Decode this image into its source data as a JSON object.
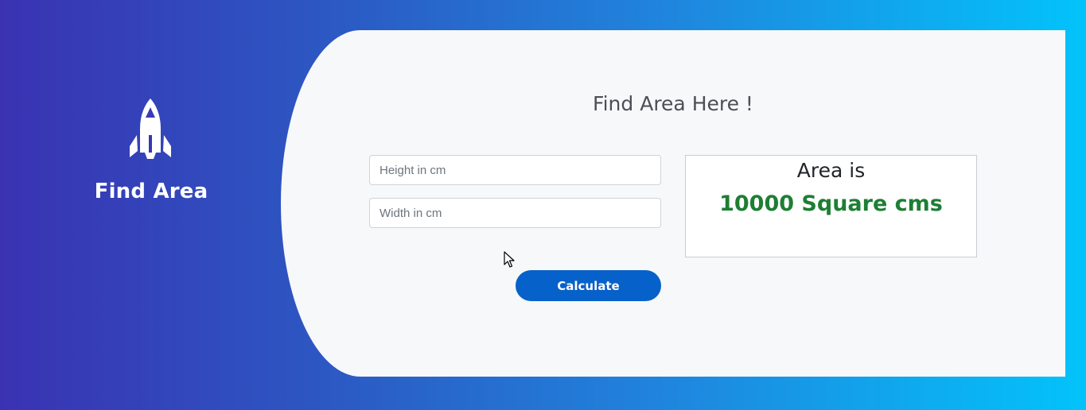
{
  "brand": {
    "title": "Find Area",
    "icon": "rocket-icon"
  },
  "card": {
    "title": "Find Area Here !"
  },
  "form": {
    "height_placeholder": "Height in cm",
    "height_value": "",
    "width_placeholder": "Width in cm",
    "width_value": "",
    "calculate_label": "Calculate"
  },
  "result": {
    "label": "Area is",
    "value": "10000 Square cms"
  },
  "colors": {
    "button": "#0761ca",
    "result_value": "#1e7e34",
    "card_background": "#f7f8fa"
  }
}
